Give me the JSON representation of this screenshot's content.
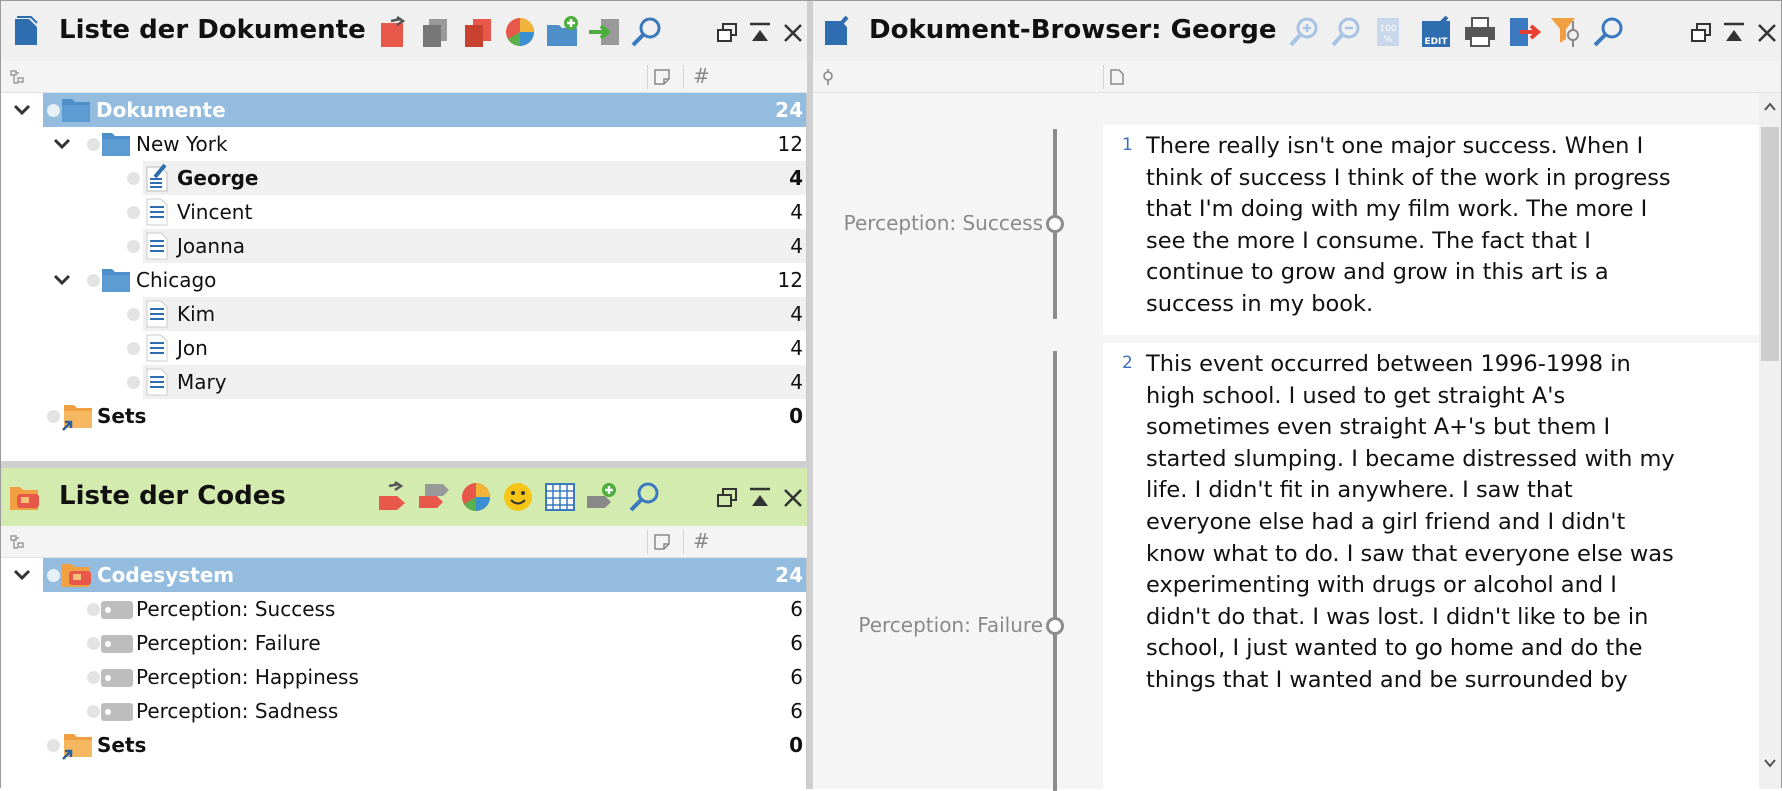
{
  "doc_panel": {
    "title": "Liste der Dokumente",
    "toolbar_icons": [
      "activate-icon",
      "copy-icon",
      "duplicate-icon",
      "pie-chart-icon",
      "new-folder-icon",
      "import-icon",
      "search-icon"
    ],
    "rows": [
      {
        "label": "Dokumente",
        "count": "24"
      },
      {
        "label": "New York",
        "count": "12"
      },
      {
        "label": "George",
        "count": "4"
      },
      {
        "label": "Vincent",
        "count": "4"
      },
      {
        "label": "Joanna",
        "count": "4"
      },
      {
        "label": "Chicago",
        "count": "12"
      },
      {
        "label": "Kim",
        "count": "4"
      },
      {
        "label": "Jon",
        "count": "4"
      },
      {
        "label": "Mary",
        "count": "4"
      },
      {
        "label": "Sets",
        "count": "0"
      }
    ]
  },
  "code_panel": {
    "title": "Liste der Codes",
    "toolbar_icons": [
      "activate-icon",
      "code-tags-icon",
      "pie-chart-icon",
      "smiley-icon",
      "table-icon",
      "new-code-icon",
      "search-icon"
    ],
    "rows": [
      {
        "label": "Codesystem",
        "count": "24"
      },
      {
        "label": "Perception: Success",
        "count": "6"
      },
      {
        "label": "Perception: Failure",
        "count": "6"
      },
      {
        "label": "Perception: Happiness",
        "count": "6"
      },
      {
        "label": "Perception: Sadness",
        "count": "6"
      },
      {
        "label": "Sets",
        "count": "0"
      }
    ]
  },
  "browser": {
    "title": "Dokument-Browser: George",
    "toolbar_icons": [
      "zoom-in-icon",
      "zoom-out-icon",
      "zoom-100-icon",
      "edit-icon",
      "print-icon",
      "export-icon",
      "filter-icon",
      "search-icon"
    ],
    "paragraphs": [
      {
        "number": "1",
        "code": "Perception: Success",
        "lines": [
          "There really isn't one major success. When I",
          "think of success I think of the work in progress",
          "that I'm doing with my film work. The more I",
          "see the more I consume. The fact that I",
          "continue to grow and grow in this art is a",
          "success in my book."
        ]
      },
      {
        "number": "2",
        "code": "Perception: Failure",
        "lines": [
          "This event occurred between 1996-1998 in",
          "high school. I used to get straight A's",
          "sometimes even straight A+'s but them I",
          "started slumping. I became distressed with my",
          "life. I didn't fit in anywhere. I saw that",
          "everyone else had a girl friend and I didn't",
          "know what to do. I saw that everyone else was",
          "experimenting with drugs or alcohol and I",
          "didn't do that.  I was lost. I didn't like to be in",
          "school, I just wanted to go home and do the",
          "things that I wanted and be surrounded by"
        ]
      }
    ]
  },
  "colors": {
    "selected_row": "#94bcdf",
    "code_header": "#d4ebb0",
    "folder": "#4f8fc9",
    "sets": "#f0a040"
  }
}
